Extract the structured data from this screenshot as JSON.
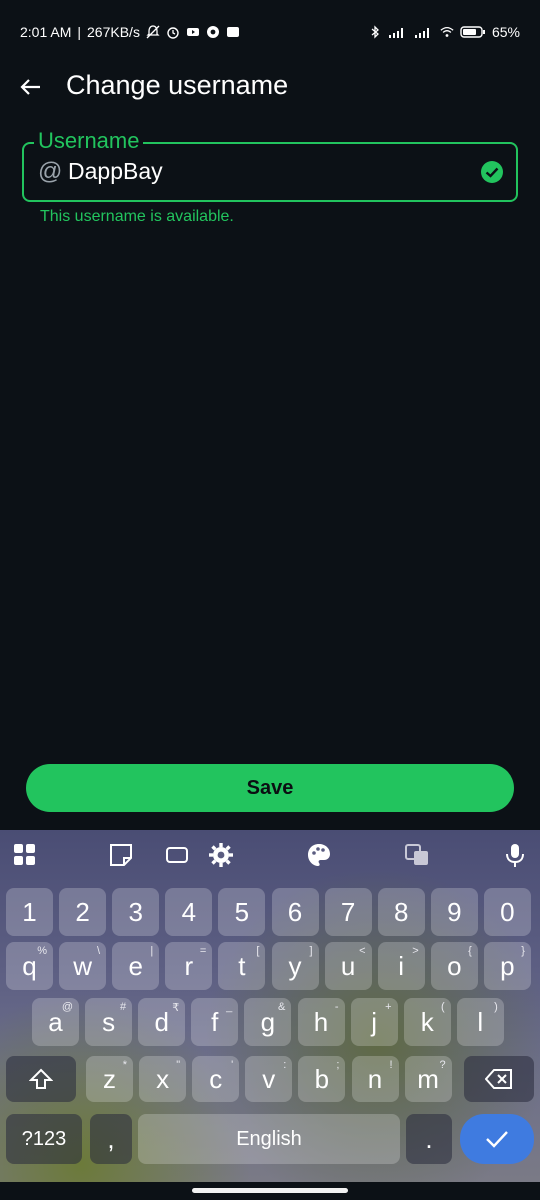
{
  "status": {
    "time": "2:01 AM",
    "speed": "267KB/s",
    "battery": "65"
  },
  "header": {
    "title": "Change username"
  },
  "form": {
    "label": "Username",
    "prefix": "@",
    "value": "DappBay",
    "helper": "This username is available."
  },
  "save_label": "Save",
  "keyboard": {
    "row1": [
      {
        "k": "1"
      },
      {
        "k": "2"
      },
      {
        "k": "3"
      },
      {
        "k": "4"
      },
      {
        "k": "5"
      },
      {
        "k": "6"
      },
      {
        "k": "7"
      },
      {
        "k": "8"
      },
      {
        "k": "9"
      },
      {
        "k": "0"
      }
    ],
    "row2": [
      {
        "k": "q",
        "h": "%"
      },
      {
        "k": "w",
        "h": "\\"
      },
      {
        "k": "e",
        "h": "|"
      },
      {
        "k": "r",
        "h": "="
      },
      {
        "k": "t",
        "h": "["
      },
      {
        "k": "y",
        "h": "]"
      },
      {
        "k": "u",
        "h": "<"
      },
      {
        "k": "i",
        "h": ">"
      },
      {
        "k": "o",
        "h": "{"
      },
      {
        "k": "p",
        "h": "}"
      }
    ],
    "row3": [
      {
        "k": "a",
        "h": "@"
      },
      {
        "k": "s",
        "h": "#"
      },
      {
        "k": "d",
        "h": "₹"
      },
      {
        "k": "f",
        "h": "_"
      },
      {
        "k": "g",
        "h": "&"
      },
      {
        "k": "h",
        "h": "-"
      },
      {
        "k": "j",
        "h": "+"
      },
      {
        "k": "k",
        "h": "("
      },
      {
        "k": "l",
        "h": ")"
      }
    ],
    "row4": [
      {
        "k": "z",
        "h": "*"
      },
      {
        "k": "x",
        "h": "\""
      },
      {
        "k": "c",
        "h": "'"
      },
      {
        "k": "v",
        "h": ":"
      },
      {
        "k": "b",
        "h": ";"
      },
      {
        "k": "n",
        "h": "!"
      },
      {
        "k": "m",
        "h": "?"
      }
    ],
    "symbols_label": "?123",
    "comma": ",",
    "space_label": "English",
    "period": "."
  },
  "colors": {
    "accent": "#22c45e",
    "background": "#0c1116",
    "enter": "#3f7be0"
  }
}
